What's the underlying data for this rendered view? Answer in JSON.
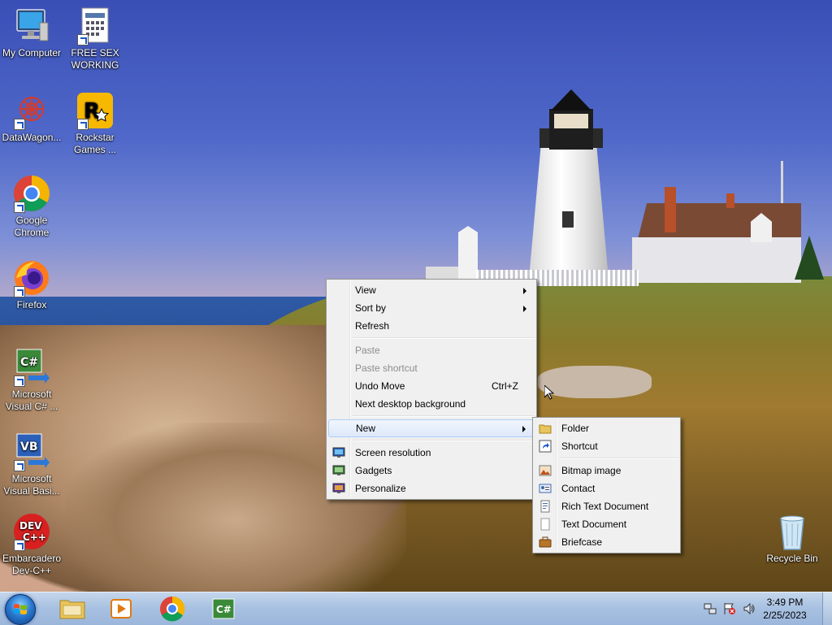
{
  "desktop": {
    "icons": [
      {
        "label": "My Computer"
      },
      {
        "label": "FREE SEX WORKING"
      },
      {
        "label": "DataWagon..."
      },
      {
        "label": "Rockstar Games ..."
      },
      {
        "label": "Google Chrome"
      },
      {
        "label": "Firefox"
      },
      {
        "label": "Microsoft Visual C# ..."
      },
      {
        "label": "Microsoft Visual Basi..."
      },
      {
        "label": "Embarcadero Dev-C++"
      },
      {
        "label": "Recycle Bin"
      }
    ]
  },
  "context_menu": {
    "items": [
      {
        "label": "View",
        "submenu": true
      },
      {
        "label": "Sort by",
        "submenu": true
      },
      {
        "label": "Refresh"
      },
      {
        "label": "Paste",
        "disabled": true
      },
      {
        "label": "Paste shortcut",
        "disabled": true
      },
      {
        "label": "Undo Move",
        "shortcut": "Ctrl+Z"
      },
      {
        "label": "Next desktop background"
      },
      {
        "label": "New",
        "submenu": true,
        "highlighted": true
      },
      {
        "label": "Screen resolution",
        "icon": "screen-resolution-icon"
      },
      {
        "label": "Gadgets",
        "icon": "gadgets-icon"
      },
      {
        "label": "Personalize",
        "icon": "personalize-icon"
      }
    ]
  },
  "new_submenu": {
    "items": [
      {
        "label": "Folder",
        "icon": "folder-icon"
      },
      {
        "label": "Shortcut",
        "icon": "shortcut-icon"
      },
      {
        "label": "Bitmap image",
        "icon": "bitmap-icon"
      },
      {
        "label": "Contact",
        "icon": "contact-icon"
      },
      {
        "label": "Rich Text Document",
        "icon": "rich-text-icon"
      },
      {
        "label": "Text Document",
        "icon": "text-document-icon"
      },
      {
        "label": "Briefcase",
        "icon": "briefcase-icon"
      }
    ]
  },
  "taskbar": {
    "pinned": [
      "explorer-icon",
      "media-player-icon",
      "chrome-icon",
      "visual-csharp-icon"
    ],
    "clock": {
      "time": "3:49 PM",
      "date": "2/25/2023"
    }
  },
  "colors": {
    "menu_bg": "#f0f0f0",
    "menu_highlight": "#dce8fa",
    "taskbar": "#a9c2e2"
  }
}
